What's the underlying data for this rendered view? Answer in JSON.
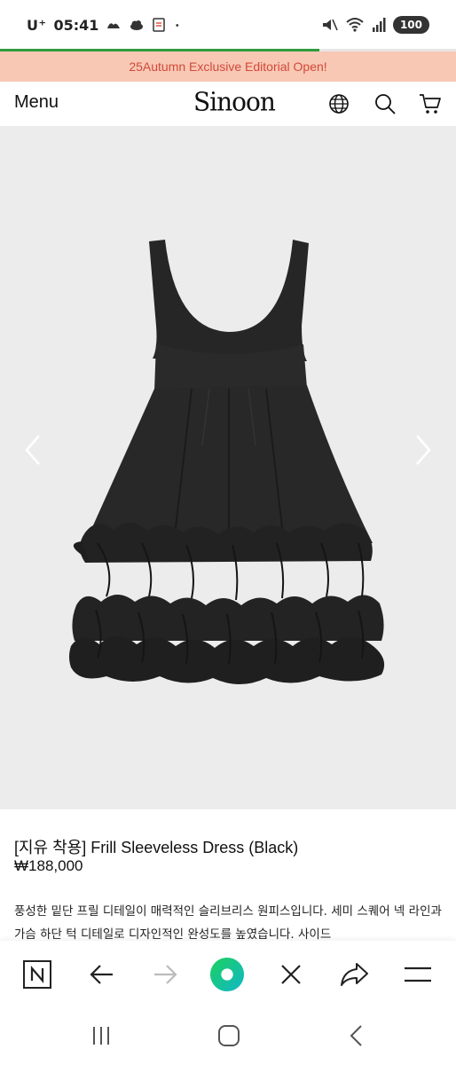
{
  "status_bar": {
    "carrier": "U⁺",
    "time": "05:41",
    "battery": "100",
    "icons": [
      "weather-icon",
      "cloud-icon",
      "note-icon",
      "dot-icon",
      "mute-icon",
      "wifi-icon",
      "signal-icon"
    ]
  },
  "page_load_progress": 0.7,
  "promo_banner": {
    "text": "25Autumn Exclusive Editorial Open!"
  },
  "header": {
    "menu_label": "Menu",
    "logo": "Sinoon",
    "icons": [
      "globe-icon",
      "search-icon",
      "cart-icon"
    ]
  },
  "product": {
    "title": "[지유 착용] Frill Sleeveless Dress (Black)",
    "price": "₩188,000",
    "description": "풍성한 밑단 프릴 디테일이 매력적인 슬리브리스 원피스입니다. 세미 스퀘어 넥 라인과 가슴 하단 턱 디테일로 디자인적인 완성도를 높였습니다. 사이드"
  },
  "gallery": {
    "prev_icon": "chevron-left-icon",
    "next_icon": "chevron-right-icon"
  },
  "browser_toolbar": {
    "buttons": [
      "naver-home-icon",
      "back-arrow-icon",
      "forward-arrow-icon",
      "green-dot-icon",
      "close-icon",
      "share-icon",
      "hamburger-icon"
    ]
  },
  "system_nav": {
    "buttons": [
      "recent-apps-icon",
      "home-icon",
      "back-icon"
    ]
  },
  "colors": {
    "promo_bg": "#f8c8b4",
    "promo_text": "#d2493a",
    "progress": "#2e9c3c",
    "hero_bg": "#ececec",
    "dress": "#262626"
  }
}
